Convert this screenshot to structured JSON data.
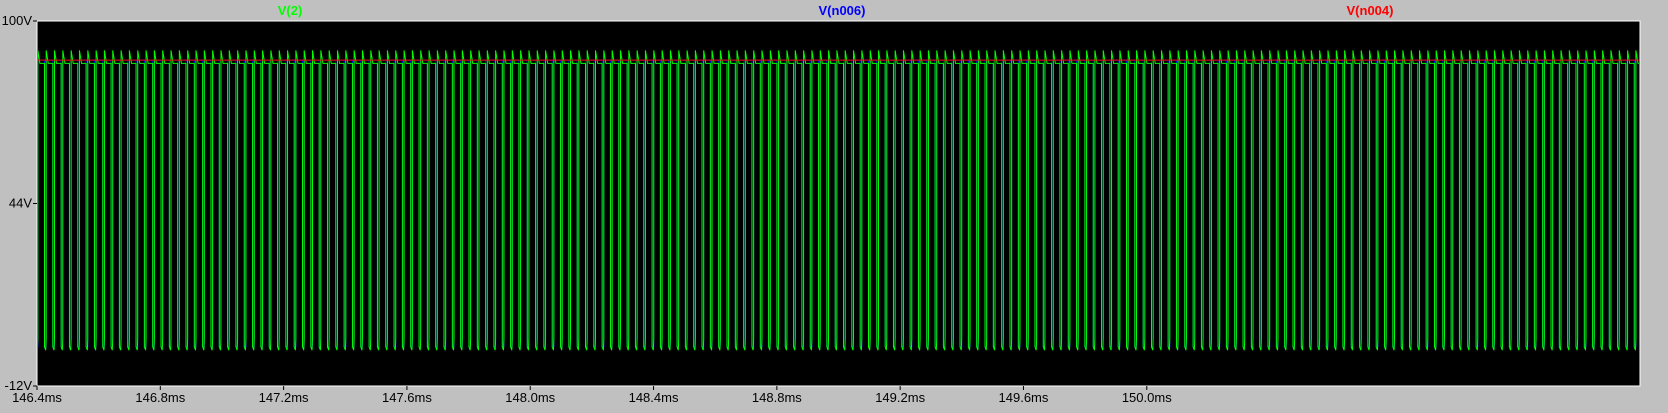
{
  "colors": {
    "background": "#c0c0c0",
    "plot_background": "#000000",
    "tick_text": "#000000",
    "plot_border": "#ffffff"
  },
  "chart_data": {
    "type": "line",
    "title": "",
    "xlabel": "",
    "ylabel": "",
    "xlim_ms": [
      146.4,
      151.6
    ],
    "ylim_v": [
      -12,
      100
    ],
    "grid": false,
    "legend_placement": "top",
    "x_ticks": [
      {
        "value": 146.4,
        "label": "146.4ms"
      },
      {
        "value": 146.8,
        "label": "146.8ms"
      },
      {
        "value": 147.2,
        "label": "147.2ms"
      },
      {
        "value": 147.6,
        "label": "147.6ms"
      },
      {
        "value": 148.0,
        "label": "148.0ms"
      },
      {
        "value": 148.4,
        "label": "148.4ms"
      },
      {
        "value": 148.8,
        "label": "148.8ms"
      },
      {
        "value": 149.2,
        "label": "149.2ms"
      },
      {
        "value": 149.6,
        "label": "149.6ms"
      },
      {
        "value": 150.0,
        "label": "150.0ms"
      }
    ],
    "y_ticks": [
      {
        "value": 100,
        "label": "100V"
      },
      {
        "value": 44,
        "label": "44V"
      },
      {
        "value": -12,
        "label": "-12V"
      }
    ],
    "series": [
      {
        "name": "V(2)",
        "color": "#00ff00",
        "shape": "sawtooth-pulses",
        "high_v": 91,
        "low_v": 0,
        "period_ms": 0.027
      },
      {
        "name": "V(n006)",
        "color": "#0000ff",
        "shape": "square-pulses",
        "high_v": 88,
        "low_v": 0,
        "period_ms": 0.027
      },
      {
        "name": "V(n004)",
        "color": "#ff0000",
        "shape": "dc",
        "level_v": 88
      }
    ]
  }
}
